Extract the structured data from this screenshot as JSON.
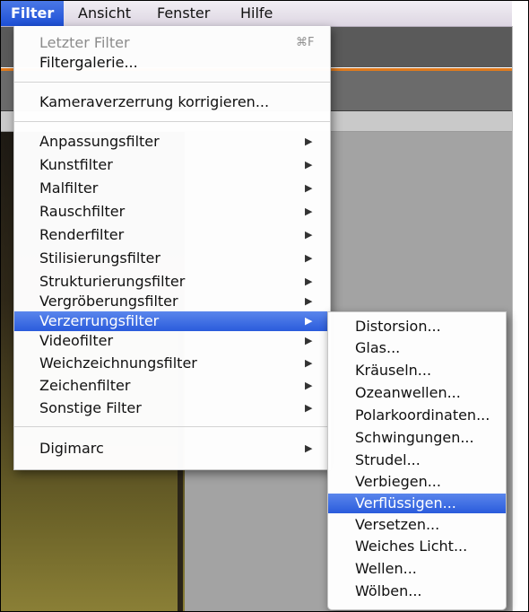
{
  "menubar": {
    "items": [
      {
        "label": "Filter"
      },
      {
        "label": "Ansicht"
      },
      {
        "label": "Fenster"
      },
      {
        "label": "Hilfe"
      }
    ]
  },
  "filter_menu": {
    "last_filter": {
      "label": "Letzter Filter",
      "shortcut": "⌘F"
    },
    "gallery": {
      "label": "Filtergalerie..."
    },
    "lens_correction": {
      "label": "Kameraverzerrung korrigieren..."
    },
    "groups": [
      {
        "label": "Anpassungsfilter"
      },
      {
        "label": "Kunstfilter"
      },
      {
        "label": "Malfilter"
      },
      {
        "label": "Rauschfilter"
      },
      {
        "label": "Renderfilter"
      },
      {
        "label": "Stilisierungsfilter"
      },
      {
        "label": "Strukturierungsfilter"
      },
      {
        "label": "Vergröberungsfilter"
      },
      {
        "label": "Verzerrungsfilter"
      },
      {
        "label": "Videofilter"
      },
      {
        "label": "Weichzeichnungsfilter"
      },
      {
        "label": "Zeichenfilter"
      },
      {
        "label": "Sonstige Filter"
      }
    ],
    "digimarc": {
      "label": "Digimarc"
    },
    "arrow": "▶"
  },
  "submenu": {
    "items": [
      {
        "label": "Distorsion..."
      },
      {
        "label": "Glas..."
      },
      {
        "label": "Kräuseln..."
      },
      {
        "label": "Ozeanwellen..."
      },
      {
        "label": "Polarkoordinaten..."
      },
      {
        "label": "Schwingungen..."
      },
      {
        "label": "Strudel..."
      },
      {
        "label": "Verbiegen..."
      },
      {
        "label": "Verflüssigen..."
      },
      {
        "label": "Versetzen..."
      },
      {
        "label": "Weiches Licht..."
      },
      {
        "label": "Wellen..."
      },
      {
        "label": "Wölben..."
      }
    ]
  },
  "colors": {
    "highlight": "#2a5bdc",
    "accent_orange": "#e07a1d"
  }
}
